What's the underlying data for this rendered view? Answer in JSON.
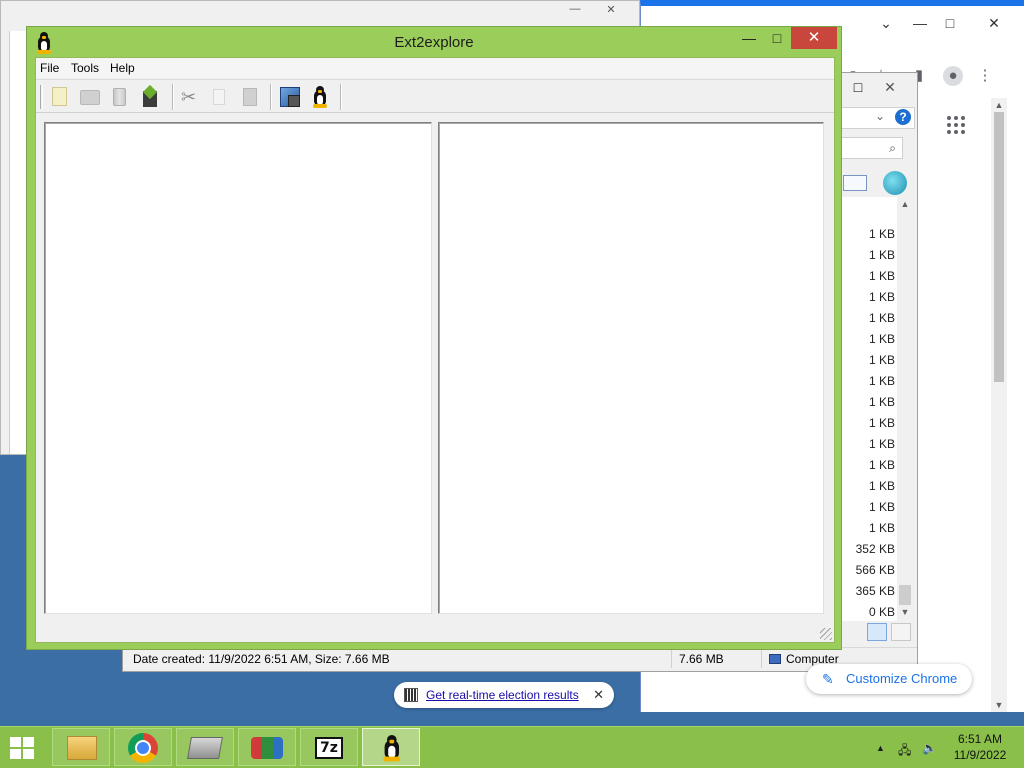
{
  "ext2explore": {
    "title": "Ext2explore",
    "controls": {
      "minimize": "—",
      "maximize": "□",
      "close": "✕"
    },
    "menu": [
      "File",
      "Tools",
      "Help"
    ]
  },
  "explorer": {
    "sizes": [
      "1 KB",
      "1 KB",
      "1 KB",
      "1 KB",
      "1 KB",
      "1 KB",
      "1 KB",
      "1 KB",
      "1 KB",
      "1 KB",
      "1 KB",
      "1 KB",
      "1 KB",
      "1 KB",
      "1 KB",
      "352 KB",
      "566 KB",
      "365 KB",
      "0 KB"
    ],
    "status_text": "Date created: 11/9/2022 6:51 AM, Size: 7.66 MB",
    "status_size": "7.66 MB",
    "status_location": "Computer",
    "search_glyph": "⌕",
    "help_glyph": "?"
  },
  "chrome": {
    "customize_label": "Customize Chrome",
    "election_link": "Get real-time election results",
    "close_glyph": "✕"
  },
  "taskbar": {
    "seven_zip_label": "7z",
    "clock_time": "6:51 AM",
    "clock_date": "11/9/2022"
  },
  "icons": {
    "ext2explore_app": "tux-icon",
    "new_file": "new-file-icon",
    "new_folder": "folder-icon",
    "delete": "trash-icon",
    "save": "save-icon",
    "cut": "scissors-icon",
    "copy": "copy-icon",
    "paste": "paste-icon",
    "properties": "properties-icon",
    "about": "tux-icon"
  },
  "colors": {
    "window_accent": "#9acd5a",
    "close_button": "#c9463d",
    "taskbar": "#8ac04a",
    "chrome_link": "#1a73e8"
  }
}
